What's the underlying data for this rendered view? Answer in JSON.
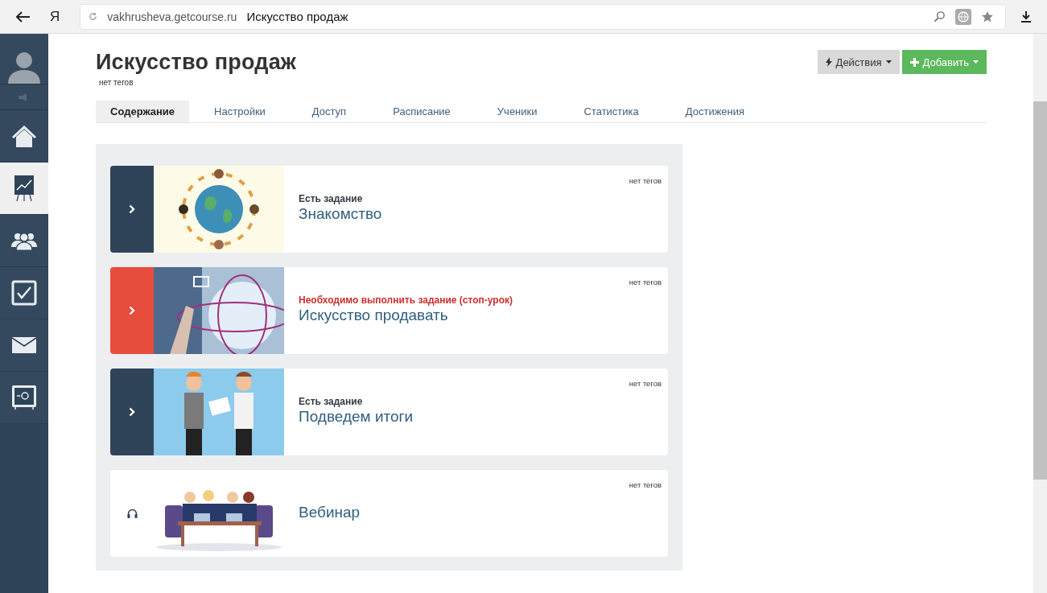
{
  "browser": {
    "logo": "Я",
    "url": "vakhrusheva.getcourse.ru",
    "page_title": "Искусство продаж"
  },
  "sidebar": {
    "items": [
      {
        "kind": "home",
        "selected": false
      },
      {
        "kind": "chart",
        "selected": true
      },
      {
        "kind": "people",
        "selected": false
      },
      {
        "kind": "check",
        "selected": false
      },
      {
        "kind": "mail",
        "selected": false
      },
      {
        "kind": "safe",
        "selected": false
      }
    ]
  },
  "header": {
    "title": "Искусство продаж",
    "tags": "нет тегов",
    "actions_button": "Действия",
    "add_button": "Добавить"
  },
  "tabs": [
    {
      "label": "Содержание",
      "selected": true
    },
    {
      "label": "Настройки",
      "selected": false
    },
    {
      "label": "Доступ",
      "selected": false
    },
    {
      "label": "Расписание",
      "selected": false
    },
    {
      "label": "Ученики",
      "selected": false
    },
    {
      "label": "Статистика",
      "selected": false
    },
    {
      "label": "Достижения",
      "selected": false
    }
  ],
  "lessons": [
    {
      "kind": "task",
      "status": "Есть задание",
      "title": "Знакомство",
      "tags": "нет тегов"
    },
    {
      "kind": "stop_lesson",
      "status": "Необходимо выполнить задание (стоп-урок)",
      "title": "Искусство продавать",
      "tags": "нет тегов"
    },
    {
      "kind": "task",
      "status": "Есть задание",
      "title": "Подведем итоги",
      "tags": "нет тегов"
    },
    {
      "kind": "webinar",
      "title": "Вебинар",
      "tags": "нет тегов"
    }
  ]
}
